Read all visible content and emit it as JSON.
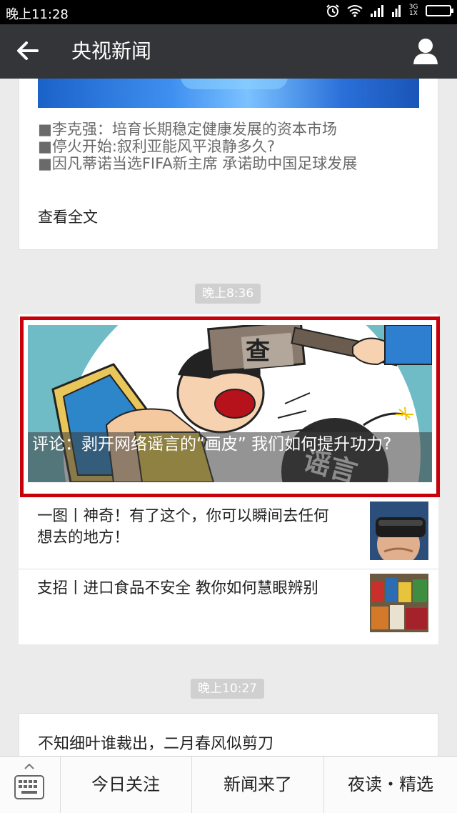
{
  "status_bar": {
    "time": "晚上11:28",
    "network_label": "3G 1X"
  },
  "nav": {
    "title": "央视新闻",
    "back_icon": "back-arrow-icon",
    "profile_icon": "person-icon"
  },
  "article1": {
    "links": [
      "■李克强：培育长期稳定健康发展的资本市场",
      "■停火开始:叙利亚能风平浪静多久?",
      "■因凡蒂诺当选FIFA新主席 承诺助中国足球发展"
    ],
    "view_all": "查看全文"
  },
  "timestamps": [
    "晚上8:36",
    "晚上10:27"
  ],
  "message2": {
    "hero_caption": "评论：剥开网络谣言的“画皮” 我们如何提升功力?",
    "hero_stamp_top": "查",
    "hero_bomb_text": "谣言",
    "items": [
      {
        "title": "一图丨神奇！有了这个，你可以瞬间去任何想去的地方！"
      },
      {
        "title": "支招丨进口食品不安全 教你如何慧眼辨别"
      }
    ]
  },
  "message3": {
    "title": "不知细叶谁裁出，二月春风似剪刀"
  },
  "bottom_menu": {
    "items": [
      "今日关注",
      "新闻来了",
      "夜读・精选"
    ]
  },
  "colors": {
    "nav_bg": "#333538",
    "highlight_border": "#c8000a",
    "page_bg": "#ebebeb"
  }
}
